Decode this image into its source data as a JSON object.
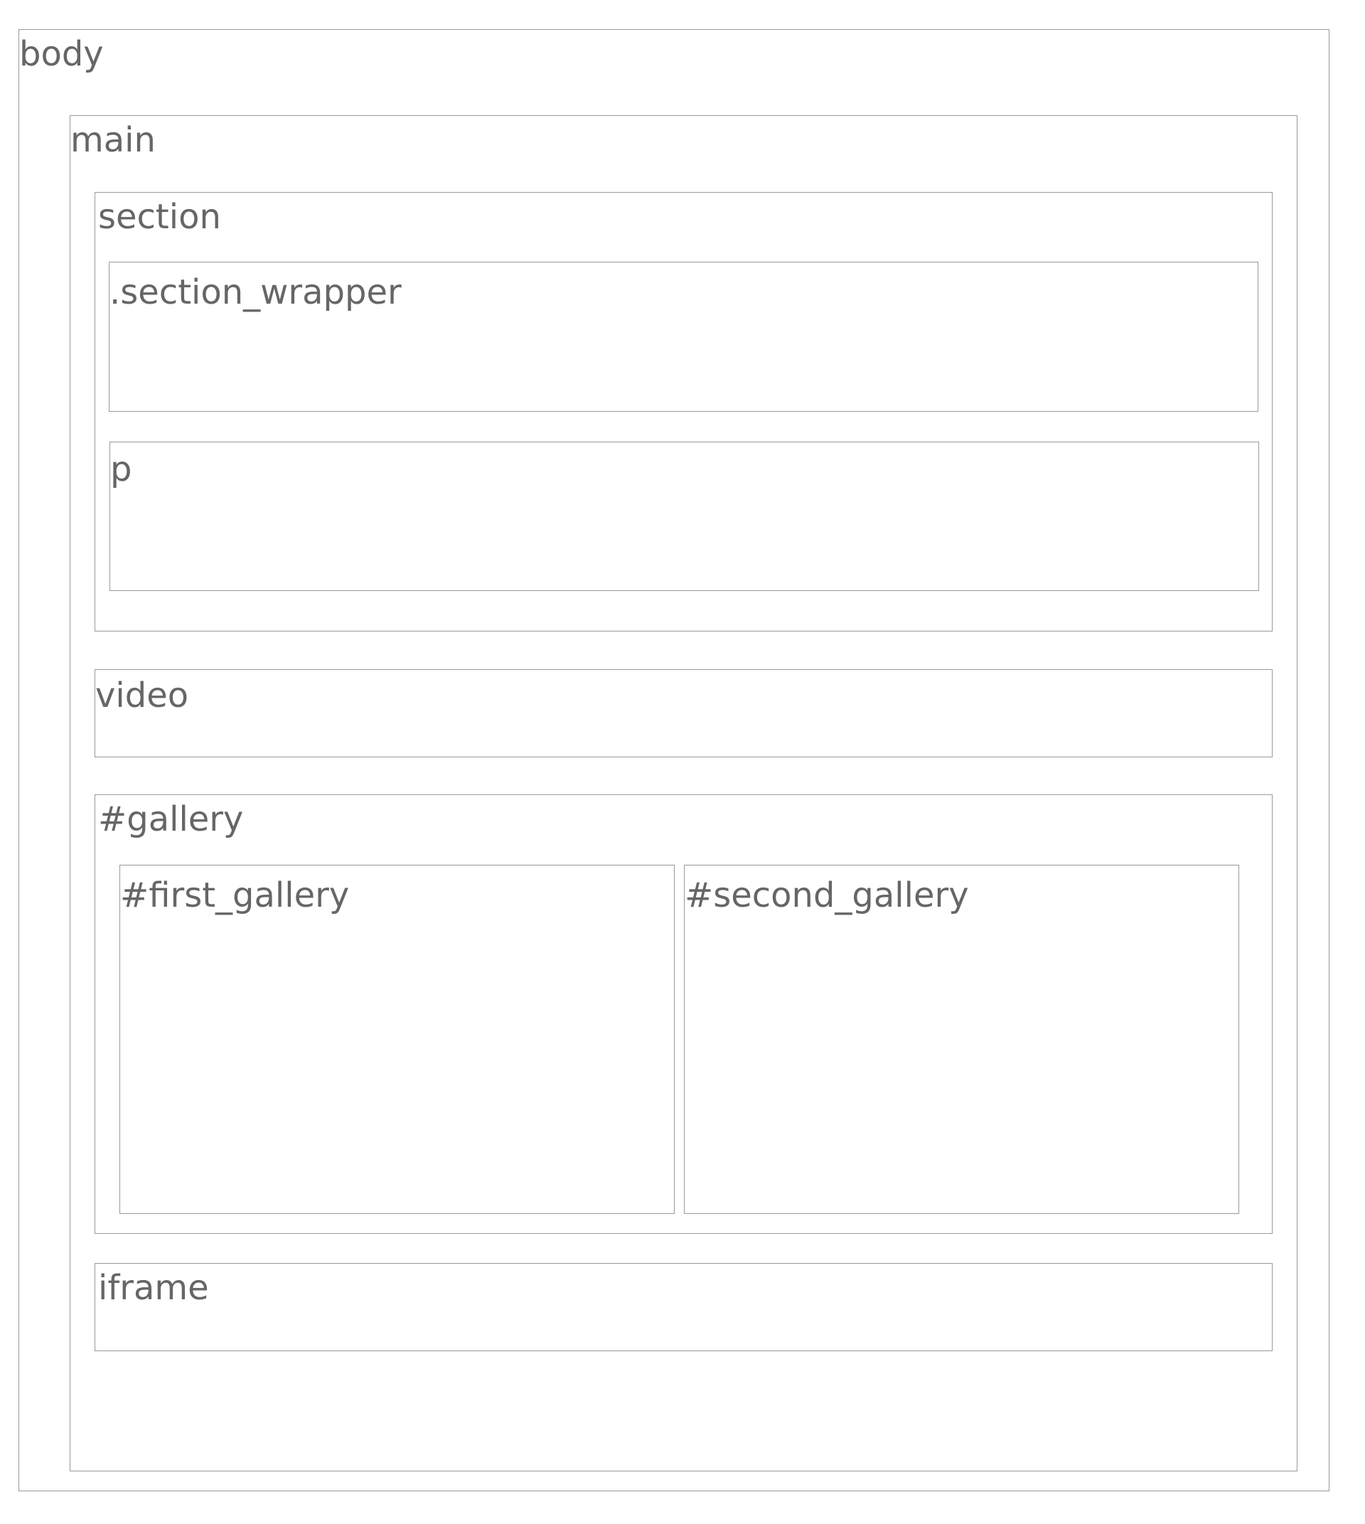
{
  "diagram": {
    "nodes": {
      "body": "body",
      "main": "main",
      "section": "section",
      "section_wrapper": ".section_wrapper",
      "p": "p",
      "video": "video",
      "gallery": "#gallery",
      "first_gallery": "#first_gallery",
      "second_gallery": "#second_gallery",
      "iframe": "iframe"
    },
    "border_color": "#999999",
    "label_color": "#666666",
    "background_color": "#ffffff"
  }
}
